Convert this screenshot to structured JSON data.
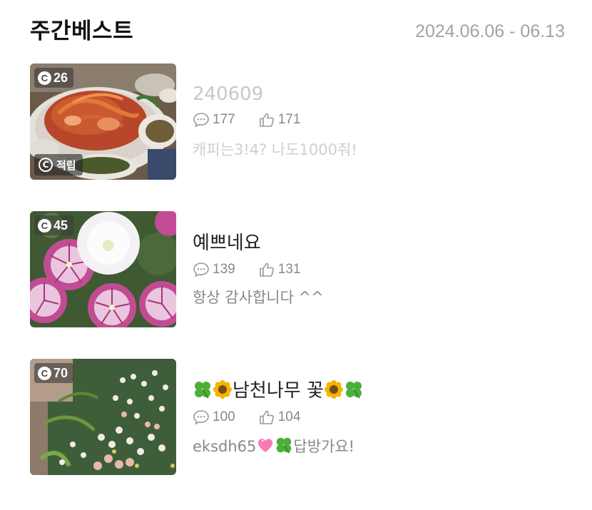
{
  "header": {
    "title": "주간베스트",
    "date_range": "2024.06.06 - 06.13"
  },
  "items": [
    {
      "badge": "26",
      "tag": "적립",
      "title": "240609",
      "comments": "177",
      "likes": "171",
      "snippet": "캐피는3!4? 나도1000줘!",
      "image": "spicy-seafood-dish-photo",
      "faded": true
    },
    {
      "badge": "45",
      "title": "예쁘네요",
      "comments": "139",
      "likes": "131",
      "snippet": "항상 감사합니다 ^^",
      "image": "petunia-flowers-photo"
    },
    {
      "badge": "70",
      "title_emoji_left": [
        "four-leaf-clover-emoji",
        "sunflower-emoji"
      ],
      "title": "남천나무 꽃",
      "title_emoji_right": [
        "sunflower-emoji",
        "four-leaf-clover-emoji"
      ],
      "comments": "100",
      "likes": "104",
      "snippet_prefix": "eksdh65",
      "snippet_emojis": [
        "pink-heart-emoji",
        "four-leaf-clover-emoji"
      ],
      "snippet_suffix": "답방가요!",
      "image": "nandina-blossom-photo"
    }
  ],
  "colors": {
    "date": "#a3a3a3",
    "meta": "#888888",
    "faded_text": "#c8c8c8"
  }
}
